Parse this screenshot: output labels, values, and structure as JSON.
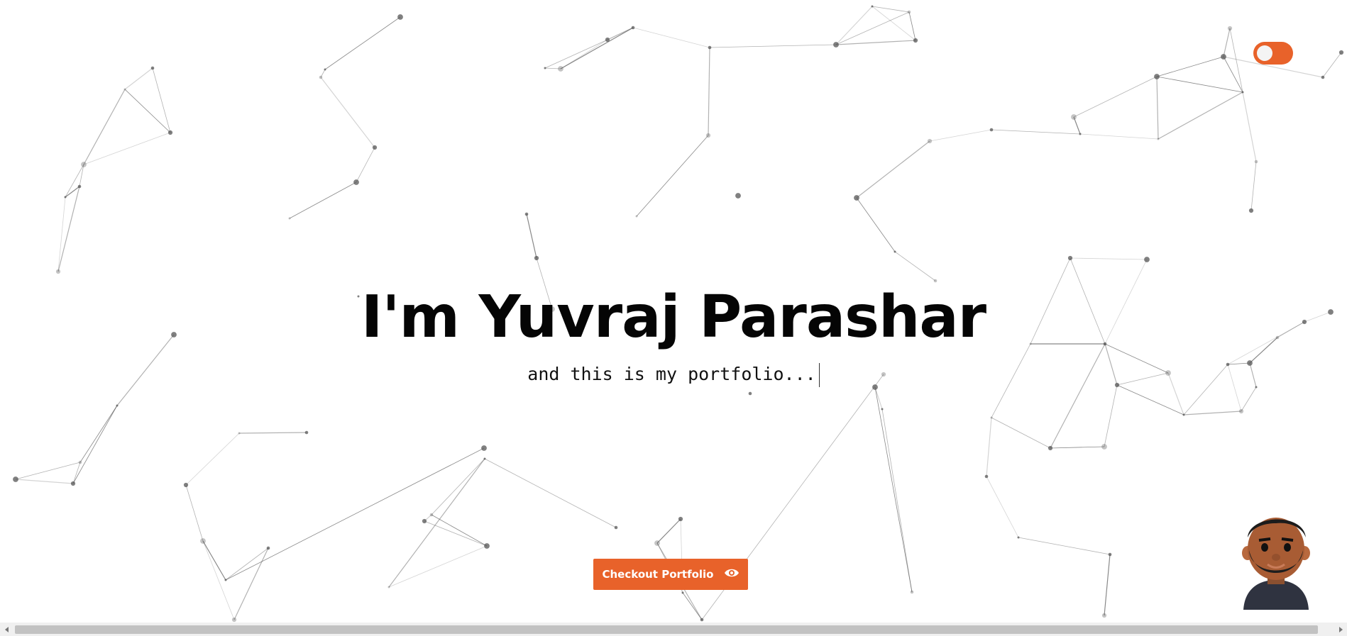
{
  "hero": {
    "title": "I'm Yuvraj Parashar",
    "subtitle": "and this is my portfolio..."
  },
  "checkout": {
    "label": "Checkout Portfolio",
    "icon": "eye-icon"
  },
  "theme_toggle": {
    "icon": "toggle-switch",
    "state": "off"
  },
  "avatar": {
    "icon": "avatar-3d-character"
  },
  "scrollbar": {
    "left_icon": "arrow-left-icon",
    "right_icon": "arrow-right-icon"
  },
  "colors": {
    "accent": "#e8622a",
    "background": "#ffffff",
    "text": "#050505"
  }
}
